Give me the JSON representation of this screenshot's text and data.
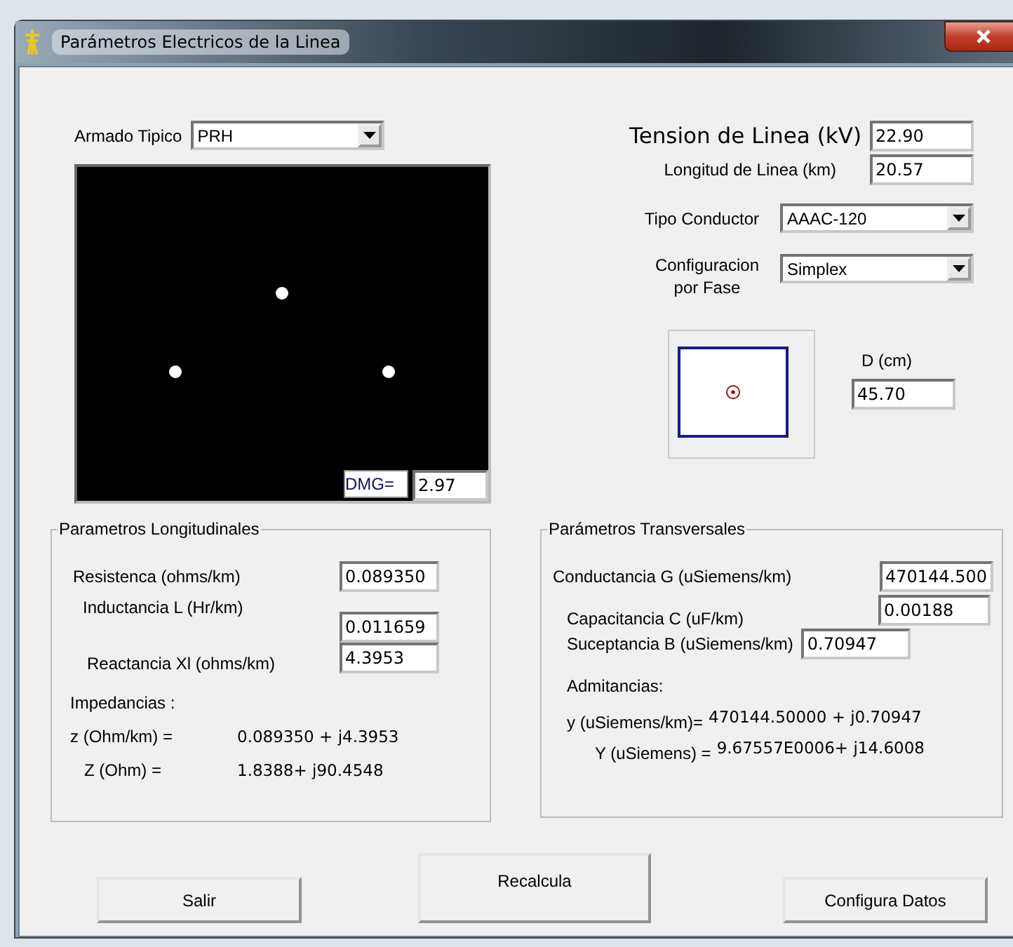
{
  "window": {
    "title": "Parámetros Electricos de la Linea"
  },
  "armado": {
    "label": "Armado Tipico",
    "value": "PRH"
  },
  "dmg": {
    "label": "DMG=",
    "value": "2.97"
  },
  "tension": {
    "label": "Tension de Linea (kV)",
    "value": "22.90"
  },
  "longitud": {
    "label": "Longitud de Linea (km)",
    "value": "20.57"
  },
  "tipo_conductor": {
    "label": "Tipo Conductor",
    "value": "AAAC-120"
  },
  "configuracion": {
    "label": "Configuracion\npor Fase",
    "value": "Simplex"
  },
  "distancia": {
    "label": "D (cm)",
    "value": "45.70"
  },
  "longitudinales": {
    "title": "Parametros Longitudinales",
    "fields": [
      {
        "label": "Resistenca (ohms/km)",
        "value": "0.089350"
      },
      {
        "label": "Inductancia L (Hr/km)",
        "value": "0.011659"
      },
      {
        "label": "Reactancia Xl (ohms/km)",
        "value": "4.3953"
      }
    ],
    "heading": "Impedancias :",
    "results": [
      {
        "label": "z (Ohm/km) =",
        "value": "0.089350 + j4.3953"
      },
      {
        "label": "Z (Ohm) =",
        "value": "1.8388+ j90.4548"
      }
    ]
  },
  "transversales": {
    "title": "Parámetros Transversales",
    "fields": [
      {
        "label": "Conductancia G (uSiemens/km)",
        "value": "470144.500"
      },
      {
        "label": "Capacitancia C (uF/km)",
        "value": "0.00188"
      },
      {
        "label": "Suceptancia B (uSiemens/km)",
        "value": "0.70947"
      }
    ],
    "heading": "Admitancias:",
    "results": [
      {
        "label": "y (uSiemens/km)=",
        "value": "470144.50000 + j0.70947"
      },
      {
        "label": "Y (uSiemens) =",
        "value": "9.67557E0006+ j14.6008"
      }
    ]
  },
  "buttons": [
    {
      "label": "Salir",
      "kind": "small"
    },
    {
      "label": "Recalcula",
      "kind": "tall"
    },
    {
      "label": "Configura Datos",
      "kind": "small"
    }
  ]
}
